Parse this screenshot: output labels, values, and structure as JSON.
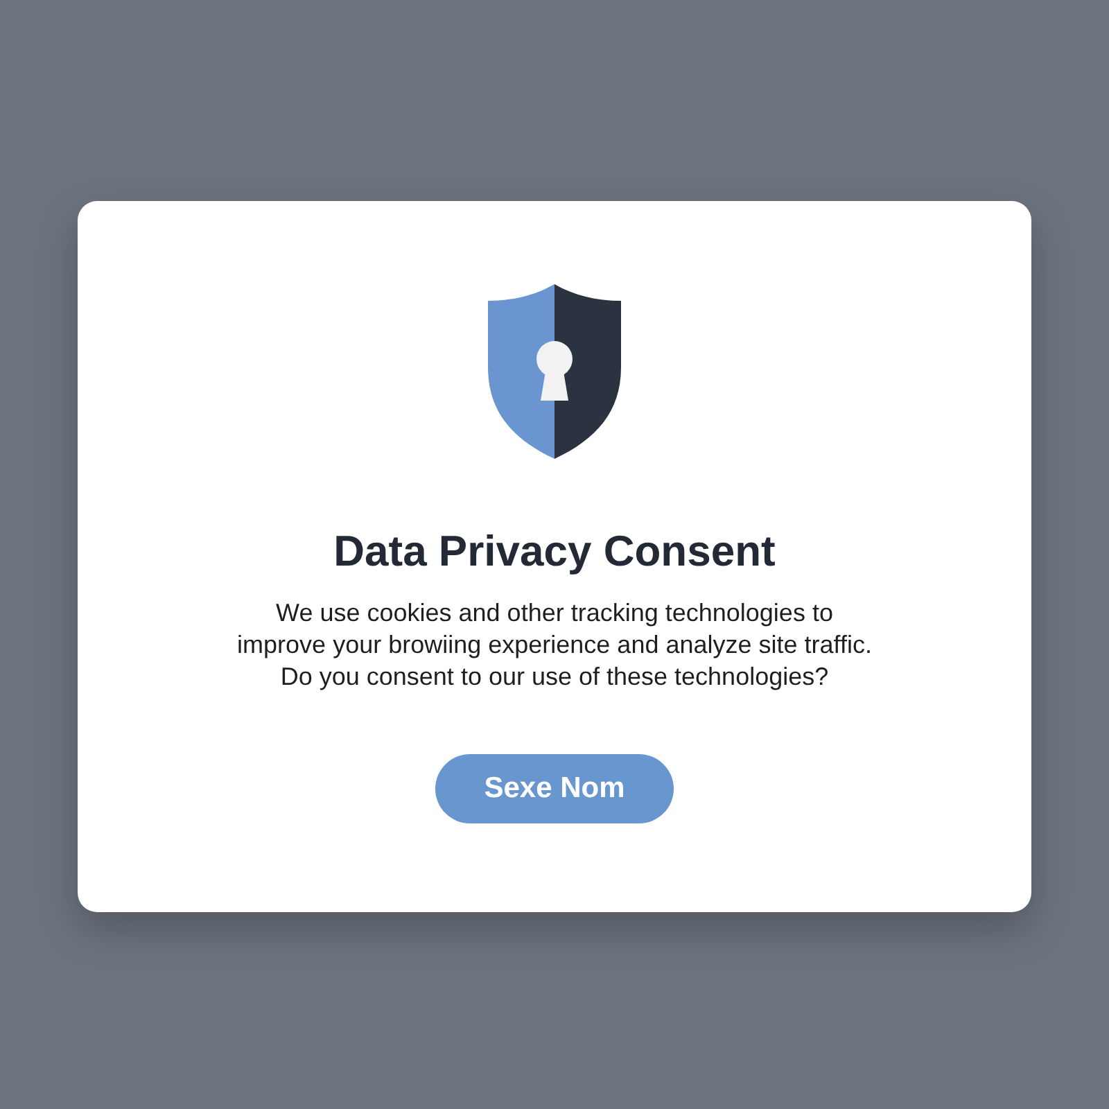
{
  "dialog": {
    "title": "Data Privacy Consent",
    "message": "We use cookies and other tracking technologies to\nimprove your browiing experience and analyze site traffic.\nDo you consent to our use of these technologies?",
    "button": "Sexe Nom"
  }
}
